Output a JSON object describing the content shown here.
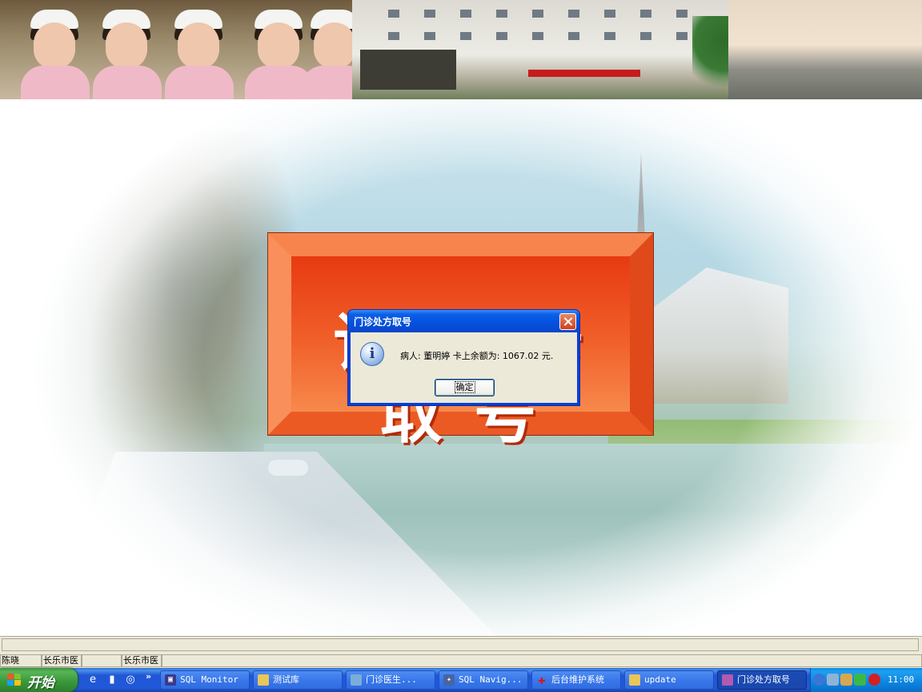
{
  "background_panel": {
    "text": "请 刷 卡 取 号"
  },
  "dialog": {
    "title": "门诊处方取号",
    "message": "病人: 董明婷 卡上余额为: 1067.02 元.",
    "ok_label": "确定"
  },
  "status_bar": {
    "panels": [
      {
        "text": "陈晓"
      },
      {
        "text": "长乐市医"
      },
      {
        "text": ""
      },
      {
        "text": "长乐市医"
      },
      {
        "text": ""
      }
    ]
  },
  "taskbar": {
    "start_label": "开始",
    "tasks": [
      {
        "label": "SQL Monitor",
        "icon": "sql-monitor-icon"
      },
      {
        "label": "测试库",
        "icon": "folder-icon"
      },
      {
        "label": "门诊医生...",
        "icon": "app-icon"
      },
      {
        "label": "SQL Navig...",
        "icon": "sql-navigator-icon"
      },
      {
        "label": "后台维护系统",
        "icon": "red-cross-icon"
      },
      {
        "label": "update",
        "icon": "folder-icon"
      },
      {
        "label": "门诊处方取号",
        "icon": "app-icon"
      }
    ],
    "clock": "11:00"
  },
  "colors": {
    "taskbar_blue": "#2158d8",
    "start_green": "#3a9a3a",
    "dialog_face": "#ece9d8",
    "banner_orange": "#ef6a2a"
  }
}
